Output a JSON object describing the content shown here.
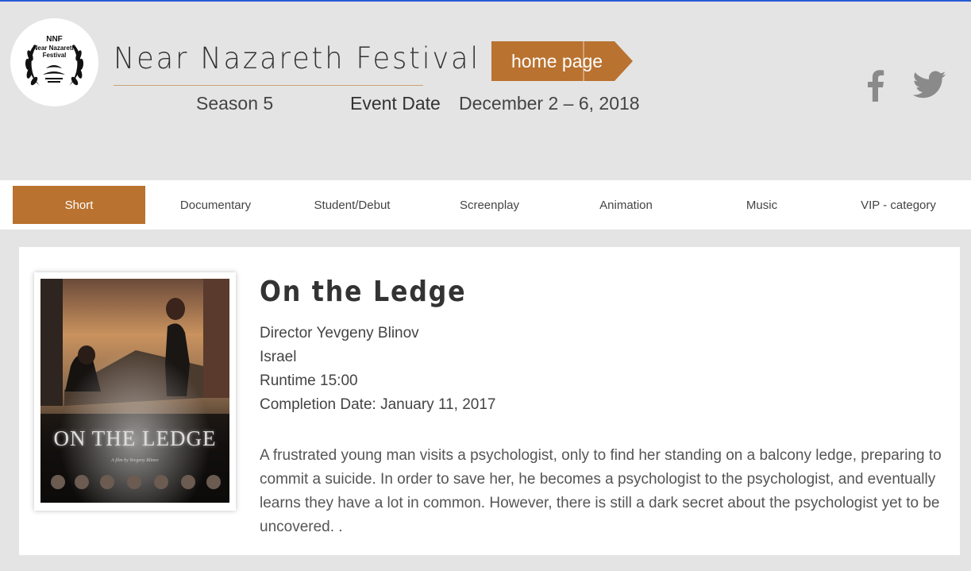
{
  "header": {
    "logo": {
      "abbr": "NNF",
      "line1": "Near Nazareth",
      "line2": "Festival"
    },
    "site_title": "Near Nazareth Festival",
    "season": "Season 5",
    "event_label": "Event Date",
    "event_date": "December 2 – 6, 2018",
    "home_button": "home page",
    "social": [
      "facebook-icon",
      "twitter-icon"
    ]
  },
  "nav": {
    "items": [
      "Short",
      "Documentary",
      "Student/Debut",
      "Screenplay",
      "Animation",
      "Music",
      "VIP - category"
    ],
    "active_index": 0
  },
  "film": {
    "title": "On the Ledge",
    "director": "Director  Yevgeny Blinov",
    "country": "Israel",
    "runtime": "Runtime 15:00",
    "completion": "Completion Date: January 11, 2017",
    "description": "A frustrated young man visits a psychologist, only to find her standing on a balcony ledge, preparing to commit a suicide. In order to save her, he becomes a psychologist to the psychologist, and eventually learns they have a lot in common. However, there is still a dark secret about the psychologist yet to be uncovered. .",
    "poster": {
      "title": "ON THE LEDGE",
      "subtitle": "A film by Yevgeny Blinov"
    }
  },
  "colors": {
    "accent": "#b9722f",
    "background": "#e4e4e4",
    "card": "#ffffff"
  }
}
